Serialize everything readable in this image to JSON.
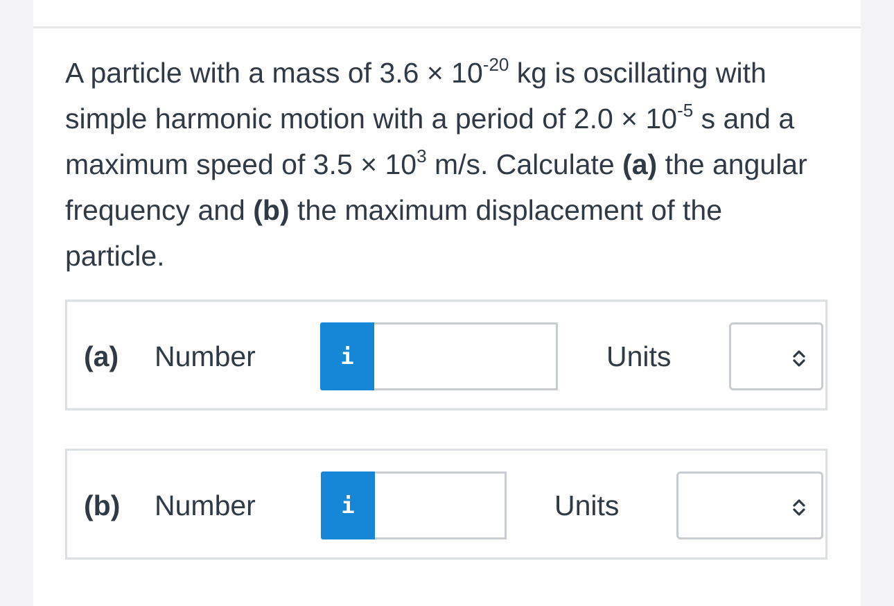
{
  "question": {
    "line1_text": "A particle with a mass of 3.6 × 10",
    "line1_exp": "-20",
    "line1_tail": " kg is oscillating with simple harmonic motion with a period of 2.0 × 10",
    "line2_exp": "-5",
    "line2_mid": " s and a maximum speed of 3.5 × 10",
    "line2_exp2": "3",
    "line2_tail": " m/s. Calculate ",
    "part_a_marker": "(a)",
    "part_a_text": " the angular frequency and ",
    "part_b_marker": "(b)",
    "part_b_text": " the maximum displacement of the particle."
  },
  "parts": [
    {
      "label": "(a)",
      "number_label": "Number",
      "info_icon": "i",
      "number_value": "",
      "units_label": "Units",
      "units_value": ""
    },
    {
      "label": "(b)",
      "number_label": "Number",
      "info_icon": "i",
      "number_value": "",
      "units_label": "Units",
      "units_value": ""
    }
  ],
  "colors": {
    "accent": "#1587d6",
    "text": "#2f3a45",
    "border": "#dcdfe3"
  }
}
